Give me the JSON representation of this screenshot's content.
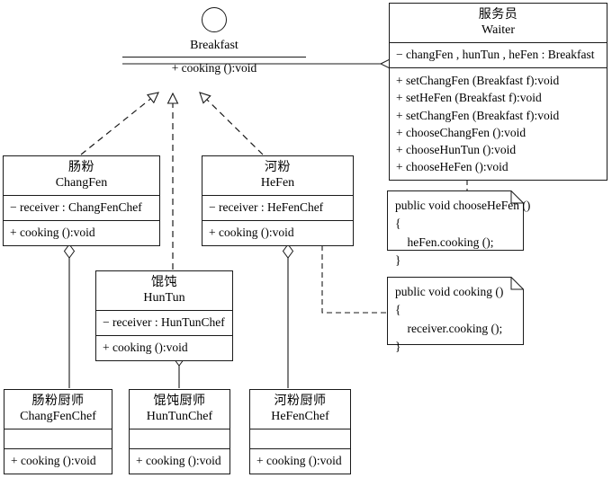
{
  "diagram": {
    "title": "Breakfast ordering UML class diagram",
    "stroke_color": "#1a1a1a",
    "background_color": "#ffffff"
  },
  "interface": {
    "name_cn": "",
    "name_en": "Breakfast",
    "operation": "+ cooking ():void"
  },
  "classes": {
    "waiter": {
      "name_cn": "服务员",
      "name_en": "Waiter",
      "attributes": [
        "− changFen , hunTun , heFen : Breakfast"
      ],
      "operations": [
        "+ setChangFen (Breakfast f):void",
        "+ setHeFen (Breakfast f):void",
        "+ setChangFen (Breakfast f):void",
        "+ chooseChangFen ():void",
        "+ chooseHunTun ():void",
        "+ chooseHeFen ():void"
      ]
    },
    "changfen": {
      "name_cn": "肠粉",
      "name_en": "ChangFen",
      "attributes": [
        "− receiver : ChangFenChef"
      ],
      "operations": [
        "+ cooking ():void"
      ]
    },
    "hefen": {
      "name_cn": "河粉",
      "name_en": "HeFen",
      "attributes": [
        "− receiver : HeFenChef"
      ],
      "operations": [
        "+ cooking ():void"
      ]
    },
    "huntun": {
      "name_cn": "馄饨",
      "name_en": "HunTun",
      "attributes": [
        "− receiver : HunTunChef"
      ],
      "operations": [
        "+ cooking ():void"
      ]
    },
    "changfenchef": {
      "name_cn": "肠粉厨师",
      "name_en": "ChangFenChef",
      "attributes": [
        ""
      ],
      "operations": [
        "+ cooking ():void"
      ]
    },
    "huntunchef": {
      "name_cn": "馄饨厨师",
      "name_en": "HunTunChef",
      "attributes": [
        ""
      ],
      "operations": [
        "+ cooking ():void"
      ]
    },
    "hefenchef": {
      "name_cn": "河粉厨师",
      "name_en": "HeFenChef",
      "attributes": [
        ""
      ],
      "operations": [
        "+ cooking ():void"
      ]
    }
  },
  "notes": {
    "choose_hefen": "public void chooseHeFen ()\n{\n    heFen.cooking ();\n}",
    "cooking": "public void cooking ()\n{\n    receiver.cooking ();\n}"
  }
}
